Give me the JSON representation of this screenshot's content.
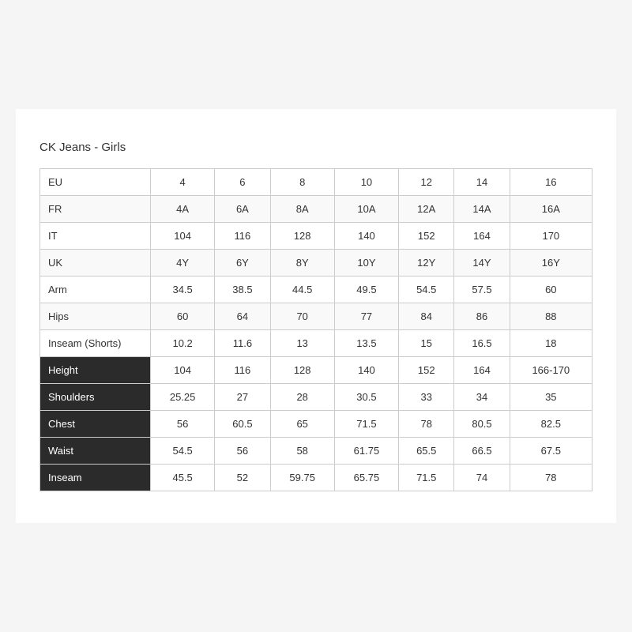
{
  "title": "CK Jeans - Girls",
  "columns": [
    "",
    "4",
    "6",
    "8",
    "10",
    "12",
    "14",
    "16"
  ],
  "light_rows": [
    {
      "label": "EU",
      "values": [
        "4",
        "6",
        "8",
        "10",
        "12",
        "14",
        "16"
      ]
    },
    {
      "label": "FR",
      "values": [
        "4A",
        "6A",
        "8A",
        "10A",
        "12A",
        "14A",
        "16A"
      ]
    },
    {
      "label": "IT",
      "values": [
        "104",
        "116",
        "128",
        "140",
        "152",
        "164",
        "170"
      ]
    },
    {
      "label": "UK",
      "values": [
        "4Y",
        "6Y",
        "8Y",
        "10Y",
        "12Y",
        "14Y",
        "16Y"
      ]
    },
    {
      "label": "Arm",
      "values": [
        "34.5",
        "38.5",
        "44.5",
        "49.5",
        "54.5",
        "57.5",
        "60"
      ]
    },
    {
      "label": "Hips",
      "values": [
        "60",
        "64",
        "70",
        "77",
        "84",
        "86",
        "88"
      ]
    },
    {
      "label": "Inseam (Shorts)",
      "values": [
        "10.2",
        "11.6",
        "13",
        "13.5",
        "15",
        "16.5",
        "18"
      ]
    }
  ],
  "dark_rows": [
    {
      "label": "Height",
      "values": [
        "104",
        "116",
        "128",
        "140",
        "152",
        "164",
        "166-170"
      ]
    },
    {
      "label": "Shoulders",
      "values": [
        "25.25",
        "27",
        "28",
        "30.5",
        "33",
        "34",
        "35"
      ]
    },
    {
      "label": "Chest",
      "values": [
        "56",
        "60.5",
        "65",
        "71.5",
        "78",
        "80.5",
        "82.5"
      ]
    },
    {
      "label": "Waist",
      "values": [
        "54.5",
        "56",
        "58",
        "61.75",
        "65.5",
        "66.5",
        "67.5"
      ]
    },
    {
      "label": "Inseam",
      "values": [
        "45.5",
        "52",
        "59.75",
        "65.75",
        "71.5",
        "74",
        "78"
      ]
    }
  ]
}
